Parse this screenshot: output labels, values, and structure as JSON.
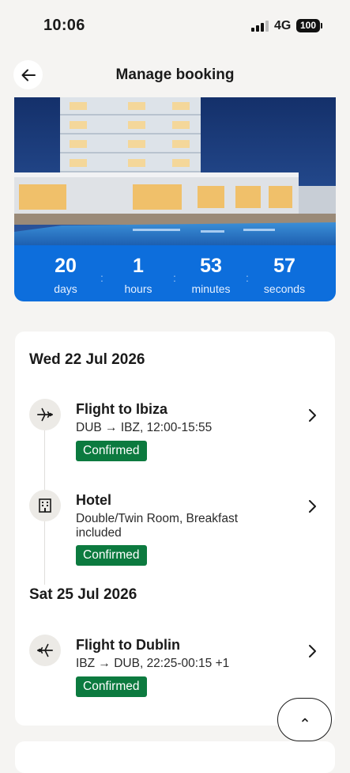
{
  "status_bar": {
    "time": "10:06",
    "network": "4G",
    "battery": "100"
  },
  "header": {
    "title": "Manage booking"
  },
  "countdown": {
    "days": "20",
    "days_label": "days",
    "hours": "1",
    "hours_label": "hours",
    "minutes": "53",
    "minutes_label": "minutes",
    "seconds": "57",
    "seconds_label": "seconds",
    "separator": ":"
  },
  "itinerary": {
    "days": [
      {
        "date": "Wed 22 Jul 2026",
        "items": [
          {
            "icon": "plane-icon",
            "title": "Flight to Ibiza",
            "subtitle": "DUB → IBZ, 12:00-15:55",
            "status": "Confirmed"
          },
          {
            "icon": "hotel-building-icon",
            "title": "Hotel",
            "subtitle": "Double/Twin Room, Breakfast included",
            "status": "Confirmed"
          }
        ]
      },
      {
        "date": "Sat 25 Jul 2026",
        "items": [
          {
            "icon": "plane-icon",
            "title": "Flight to Dublin",
            "subtitle": "IBZ → DUB, 22:25-00:15 +1",
            "status": "Confirmed"
          }
        ]
      }
    ]
  },
  "colors": {
    "accent_blue": "#0d6edc",
    "confirmed_green": "#0c7a3f",
    "background": "#f5f4f2"
  }
}
